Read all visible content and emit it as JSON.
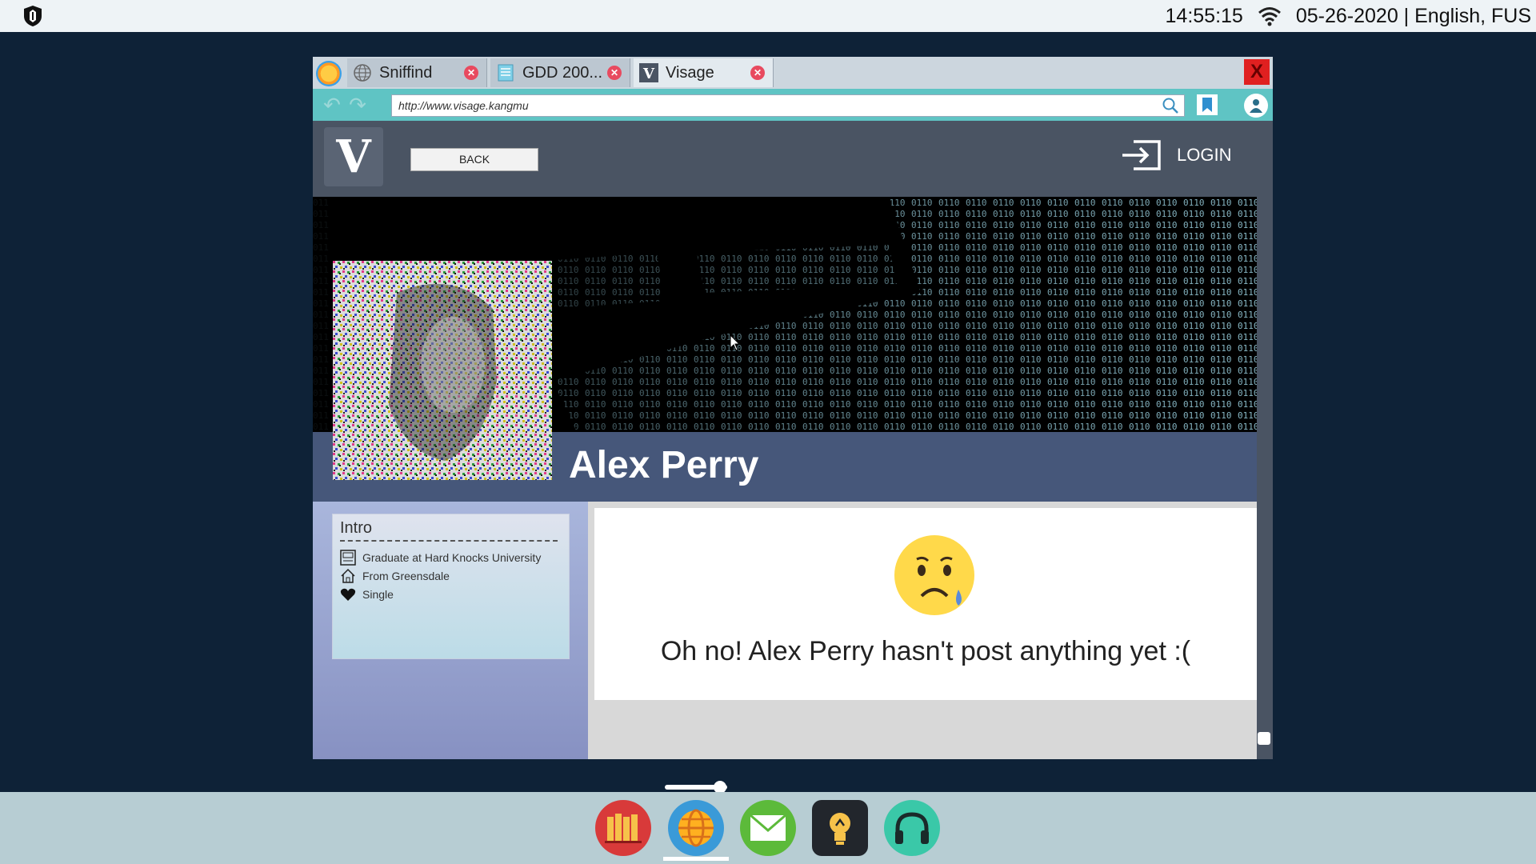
{
  "system": {
    "time": "14:55:15",
    "date_locale": "05-26-2020 | English, FUS"
  },
  "browser": {
    "tabs": [
      {
        "label": "Sniffind",
        "icon": "globe-icon"
      },
      {
        "label": "GDD 200...",
        "icon": "document-icon"
      },
      {
        "label": "Visage",
        "icon": "visage-logo-icon"
      }
    ],
    "close_label": "X",
    "url": "http://www.visage.kangmu"
  },
  "page": {
    "logo_letter": "V",
    "back_label": "BACK",
    "login_label": "LOGIN",
    "profile_name": "Alex Perry",
    "intro": {
      "title": "Intro",
      "items": [
        {
          "icon": "school-icon",
          "text": "Graduate at Hard Knocks University"
        },
        {
          "icon": "home-icon",
          "text": "From Greensdale"
        },
        {
          "icon": "heart-icon",
          "text": "Single"
        }
      ]
    },
    "empty_message": "Oh no! Alex Perry hasn't post anything yet :("
  },
  "dock": {
    "apps": [
      "library-icon",
      "browser-icon",
      "mail-icon",
      "idea-icon",
      "headphones-icon"
    ]
  },
  "colors": {
    "desktop": "#0e2237",
    "accent": "#5fc4c4",
    "name_band": "#46577a"
  }
}
